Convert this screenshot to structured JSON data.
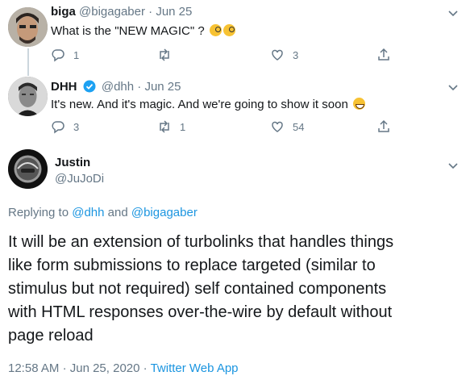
{
  "tweets": [
    {
      "name": "biga",
      "handle": "@bigagaber",
      "separator": "·",
      "date": "Jun 25",
      "text": "What is the \"NEW MAGIC\" ?",
      "reply_count": "1",
      "retweet_count": "",
      "like_count": "3"
    },
    {
      "name": "DHH",
      "handle": "@dhh",
      "separator": "·",
      "date": "Jun 25",
      "text": "It's new. And it's magic. And we're going to show it soon",
      "reply_count": "3",
      "retweet_count": "1",
      "like_count": "54"
    }
  ],
  "main": {
    "name": "Justin",
    "handle": "@JuJoDi",
    "replying_prefix": "Replying to",
    "replying_user1": "@dhh",
    "replying_and": "and",
    "replying_user2": "@bigagaber",
    "text_lines": [
      "It will be an extension of turbolinks that handles things",
      "like form submissions to replace targeted (similar to",
      "stimulus but not required) self contained components",
      "with HTML responses over-the-wire by default without",
      "page reload"
    ],
    "time": "12:58 AM",
    "separator": "·",
    "date": "Jun 25, 2020",
    "separator2": "·",
    "source": "Twitter Web App"
  },
  "colors": {
    "accent": "#1b95e0",
    "muted": "#657786",
    "text": "#14171a",
    "line": "#ccd6dd"
  }
}
